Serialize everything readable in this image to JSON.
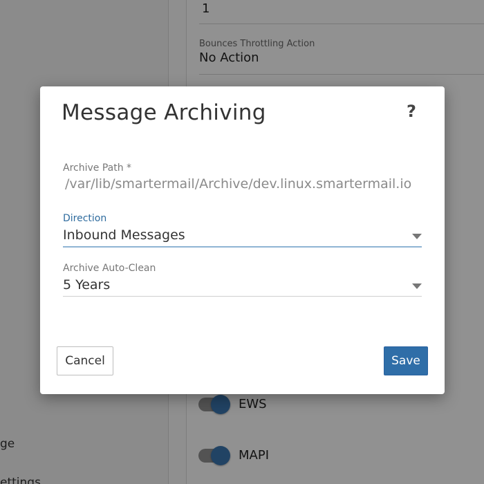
{
  "background": {
    "top_value": "1",
    "bounces_label": "Bounces Throttling Action",
    "bounces_value": "No Action",
    "left_items": [
      "ge",
      "ettings"
    ],
    "toggles": [
      {
        "label": "EWS",
        "on": true
      },
      {
        "label": "MAPI",
        "on": true
      }
    ]
  },
  "modal": {
    "title": "Message Archiving",
    "help_icon": "question-mark-icon",
    "archive_path": {
      "label": "Archive Path *",
      "value": "/var/lib/smartermail/Archive/dev.linux.smartermail.io"
    },
    "direction": {
      "label": "Direction",
      "value": "Inbound Messages"
    },
    "auto_clean": {
      "label": "Archive Auto-Clean",
      "value": "5 Years"
    },
    "cancel_label": "Cancel",
    "save_label": "Save"
  },
  "colors": {
    "accent": "#2f6ea8",
    "toggle_knob": "#3a74ad"
  }
}
